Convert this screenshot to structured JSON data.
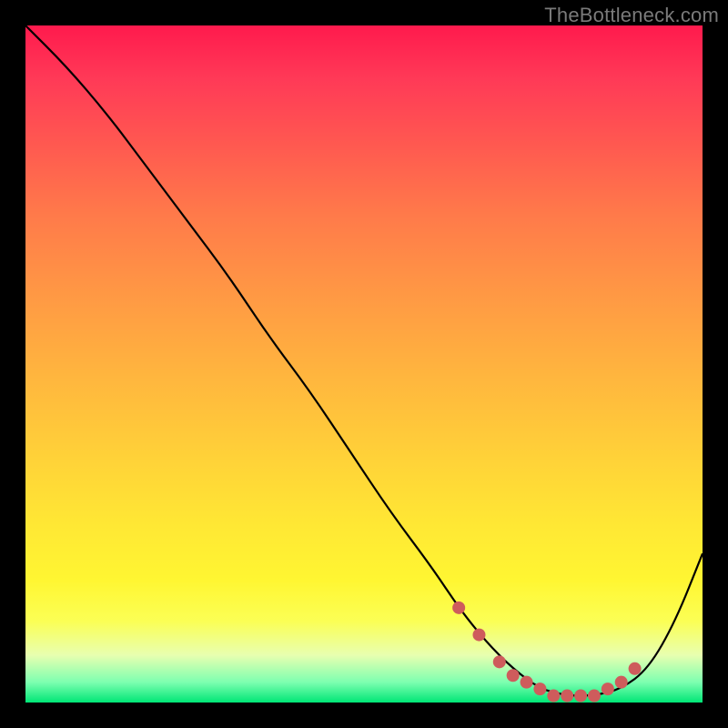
{
  "watermark": "TheBottleneck.com",
  "chart_data": {
    "type": "line",
    "title": "",
    "xlabel": "",
    "ylabel": "",
    "xlim": [
      0,
      100
    ],
    "ylim": [
      0,
      100
    ],
    "grid": false,
    "legend": false,
    "series": [
      {
        "name": "curve",
        "x": [
          0,
          6,
          12,
          18,
          24,
          30,
          36,
          42,
          48,
          54,
          60,
          64,
          68,
          72,
          76,
          80,
          84,
          88,
          92,
          96,
          100
        ],
        "y": [
          100,
          94,
          87,
          79,
          71,
          63,
          54,
          46,
          37,
          28,
          20,
          14,
          9,
          5,
          2,
          1,
          1,
          2,
          5,
          12,
          22
        ]
      },
      {
        "name": "highlight-dots",
        "x": [
          64,
          67,
          70,
          72,
          74,
          76,
          78,
          80,
          82,
          84,
          86,
          88,
          90
        ],
        "y": [
          14,
          10,
          6,
          4,
          3,
          2,
          1,
          1,
          1,
          1,
          2,
          3,
          5
        ]
      }
    ],
    "colors": {
      "curve": "#000000",
      "dots": "#ce5c5c"
    }
  }
}
